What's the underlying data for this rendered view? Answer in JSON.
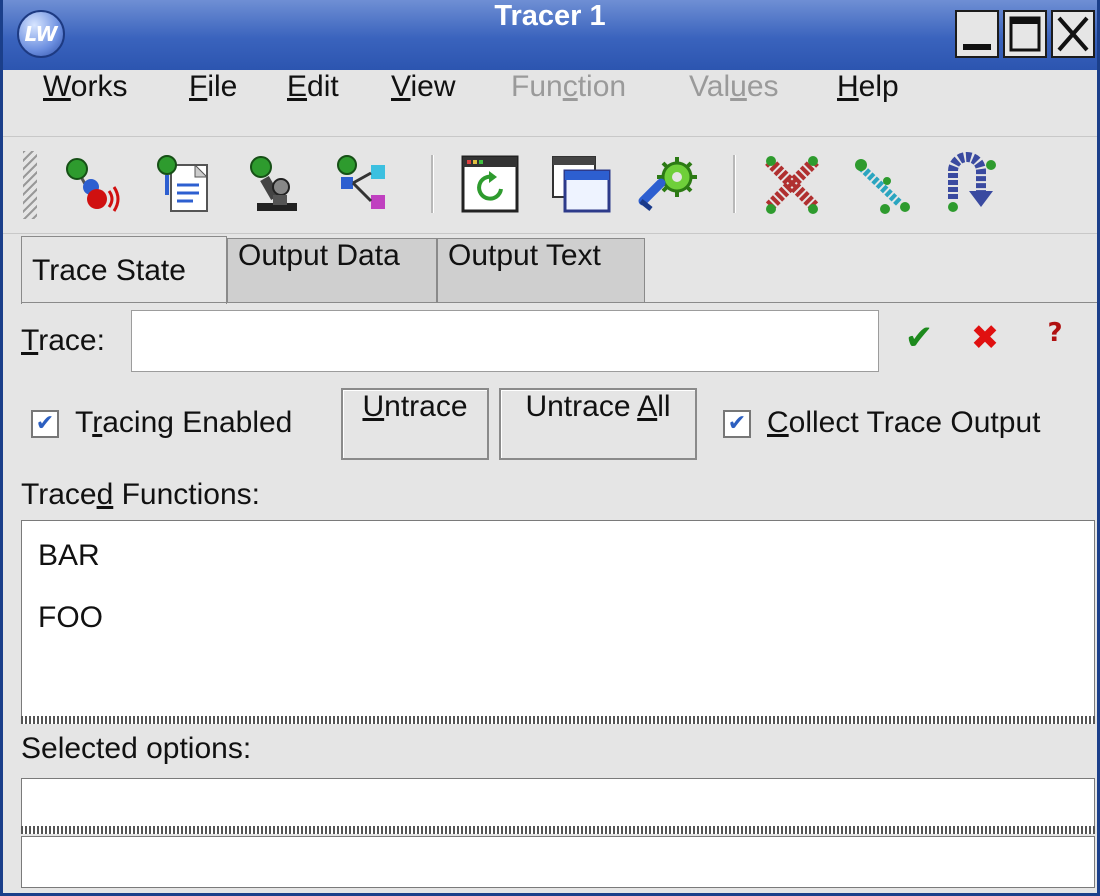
{
  "window": {
    "title": "Tracer 1",
    "logo_text": "LW",
    "title_color": "#3a63bd"
  },
  "menu": {
    "items": [
      {
        "label_ul": "W",
        "label_rest": "orks",
        "enabled": true
      },
      {
        "label_ul": "F",
        "label_rest": "ile",
        "enabled": true
      },
      {
        "label_ul": "E",
        "label_rest": "dit",
        "enabled": true
      },
      {
        "label_ul": "V",
        "label_rest": "iew",
        "enabled": true
      },
      {
        "label_pre": "Fun",
        "label_ul": "c",
        "label_rest": "tion",
        "enabled": false
      },
      {
        "label_pre": "Val",
        "label_ul": "u",
        "label_rest": "es",
        "enabled": false
      },
      {
        "label_ul": "H",
        "label_rest": "elp",
        "enabled": true
      }
    ]
  },
  "toolbar": {
    "icons": [
      "listener-icon",
      "editor-icon",
      "inspector-icon",
      "class-browser-icon",
      "refresh-window-icon",
      "windows-icon",
      "tools-gear-icon",
      "untrace-all-icon",
      "step-icon",
      "restart-icon"
    ]
  },
  "tabs": [
    {
      "label": "Trace State",
      "active": true
    },
    {
      "label": "Output Data",
      "active": false
    },
    {
      "label": "Output Text",
      "active": false
    }
  ],
  "trace": {
    "label_ul": "T",
    "label_rest": "race:",
    "value": ""
  },
  "options": {
    "tracing_enabled": {
      "pre": "T",
      "ul": "r",
      "rest": "acing Enabled",
      "checked": true
    },
    "untrace_button": {
      "ul": "U",
      "rest": "ntrace"
    },
    "untrace_all_button": {
      "pre": "Untrace ",
      "ul": "A",
      "rest": "ll"
    },
    "collect_output": {
      "ul": "C",
      "rest": "ollect Trace Output",
      "checked": true
    }
  },
  "traced_functions": {
    "label_pre": "Trace",
    "label_ul": "d",
    "label_rest": " Functions:",
    "items": [
      "BAR",
      "FOO"
    ]
  },
  "selected_options": {
    "label": "Selected options:",
    "value": ""
  },
  "colors": {
    "accept": "#1d8a1d",
    "cancel": "#e01010",
    "check": "#2c5fc0"
  }
}
